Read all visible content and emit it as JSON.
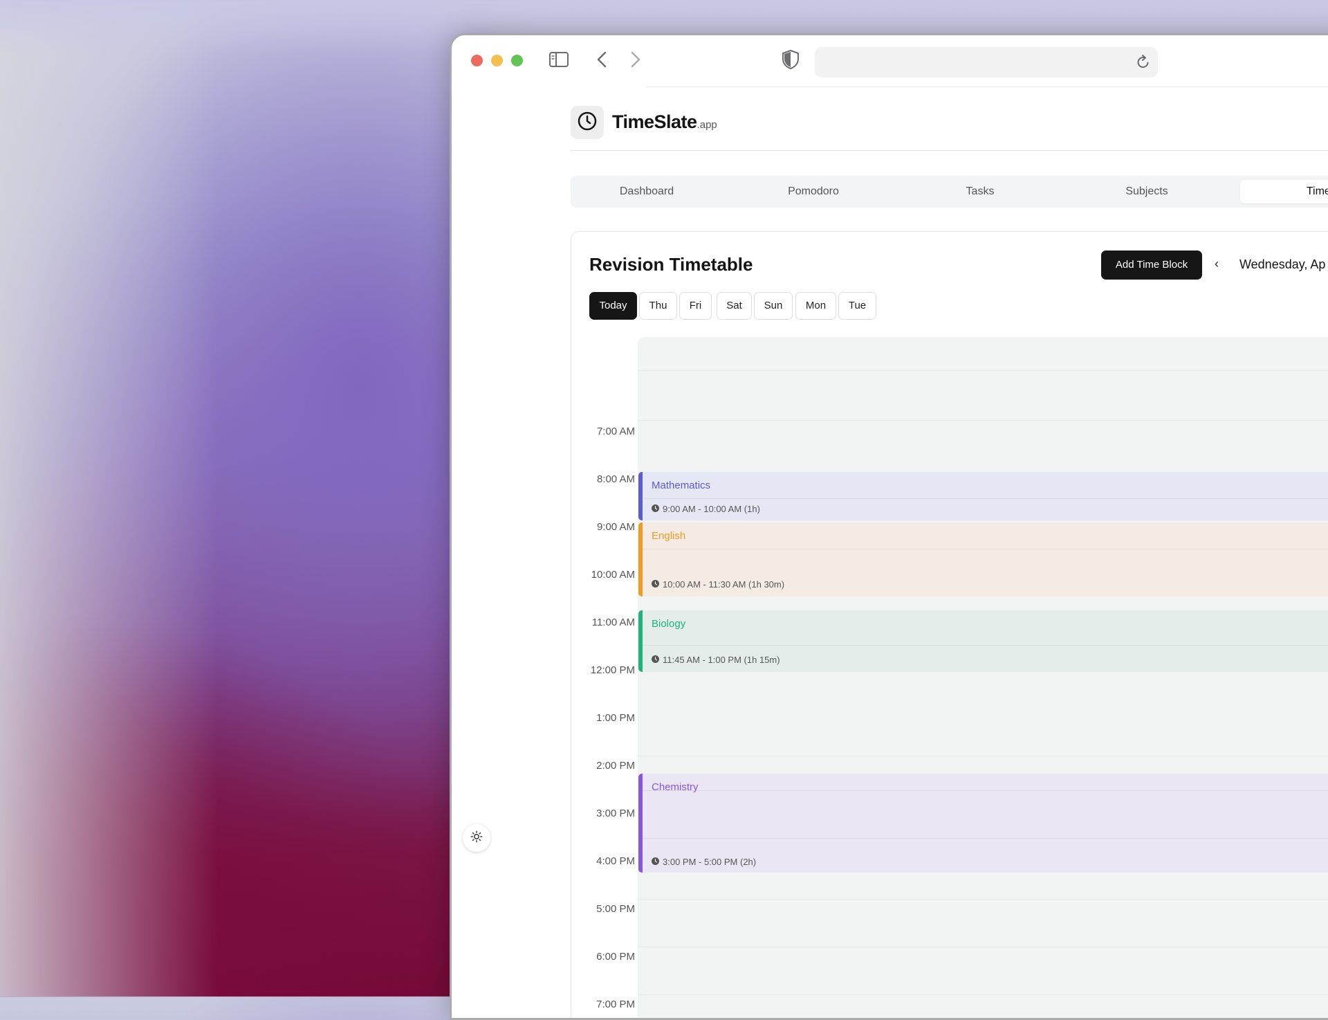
{
  "browser": {
    "url": "",
    "icons": [
      "sidebar-toggle-icon",
      "back-arrow-icon",
      "forward-arrow-icon",
      "privacy-shield-icon",
      "reload-icon"
    ]
  },
  "app": {
    "name": "TimeSlate",
    "suffix": ".app",
    "logo_icon": "clock-icon"
  },
  "nav": {
    "tabs": [
      {
        "label": "Dashboard",
        "active": false
      },
      {
        "label": "Pomodoro",
        "active": false
      },
      {
        "label": "Tasks",
        "active": false
      },
      {
        "label": "Subjects",
        "active": false
      },
      {
        "label": "Timeta",
        "active": true
      }
    ]
  },
  "timetable": {
    "title": "Revision Timetable",
    "add_button": "Add Time Block",
    "prev_icon": "‹",
    "date_label": "Wednesday, Ap",
    "days": [
      {
        "label": "Today",
        "active": true
      },
      {
        "label": "Thu",
        "active": false
      },
      {
        "label": "Fri",
        "active": false
      },
      {
        "label": "Sat",
        "active": false
      },
      {
        "label": "Sun",
        "active": false
      },
      {
        "label": "Mon",
        "active": false
      },
      {
        "label": "Tue",
        "active": false
      }
    ],
    "hours": [
      "7:00 AM",
      "8:00 AM",
      "9:00 AM",
      "10:00 AM",
      "11:00 AM",
      "12:00 PM",
      "1:00 PM",
      "2:00 PM",
      "3:00 PM",
      "4:00 PM",
      "5:00 PM",
      "6:00 PM",
      "7:00 PM"
    ],
    "blocks": [
      {
        "subject": "Mathematics",
        "time": "9:00 AM - 10:00 AM (1h)",
        "color": "#5b5bd6",
        "bg": "#e6e7f4"
      },
      {
        "subject": "English",
        "time": "10:00 AM - 11:30 AM (1h 30m)",
        "color": "#f29a1f",
        "bg": "#f4ebe5"
      },
      {
        "subject": "Biology",
        "time": "11:45 AM - 1:00 PM (1h 15m)",
        "color": "#1db47a",
        "bg": "#e4ede9"
      },
      {
        "subject": "Chemistry",
        "time": "3:00 PM - 5:00 PM (2h)",
        "color": "#8a55e0",
        "bg": "#eae6f4"
      }
    ]
  },
  "theme_toggle_icon": "sun-icon"
}
